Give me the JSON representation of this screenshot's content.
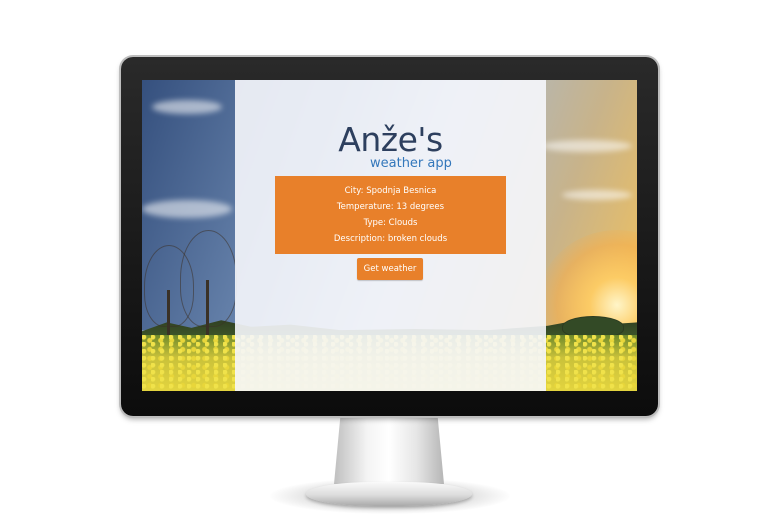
{
  "app": {
    "title": "Anže's",
    "subtitle": "weather app"
  },
  "weather": {
    "city_line": "City: Spodnja Besnica",
    "temperature_line": "Temperature: 13 degrees",
    "type_line": "Type: Clouds",
    "description_line": "Description: broken clouds"
  },
  "actions": {
    "get_weather_label": "Get weather"
  },
  "colors": {
    "accent": "#e8802a",
    "title": "#2d3f5e",
    "subtitle": "#3377bb"
  }
}
